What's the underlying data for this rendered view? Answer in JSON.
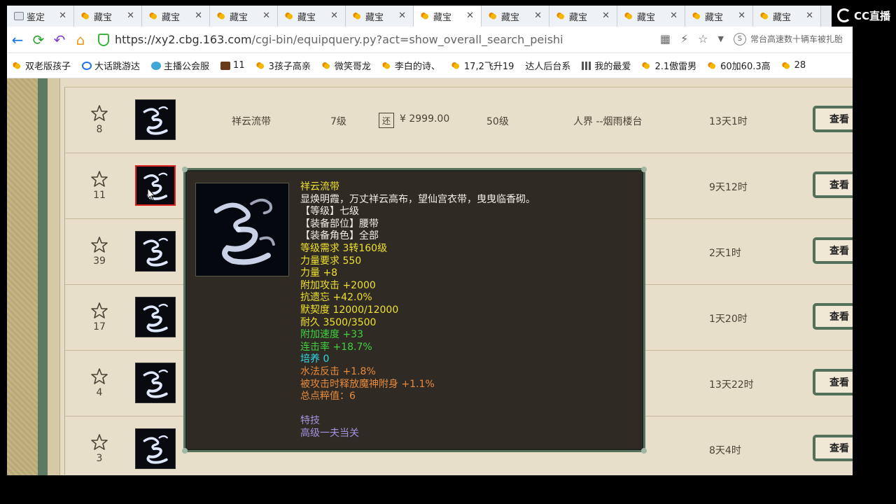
{
  "browser": {
    "tabs": [
      {
        "label": "鉴定"
      },
      {
        "label": "藏宝"
      },
      {
        "label": "藏宝"
      },
      {
        "label": "藏宝"
      },
      {
        "label": "藏宝"
      },
      {
        "label": "藏宝"
      },
      {
        "label": "藏宝"
      },
      {
        "label": "藏宝"
      },
      {
        "label": "藏宝"
      },
      {
        "label": "藏宝"
      },
      {
        "label": "藏宝"
      },
      {
        "label": "藏宝"
      }
    ],
    "active_tab_index": 6,
    "url_host": "https://xy2.cbg.163.com",
    "url_path": "/cgi-bin/equipquery.py?act=show_overall_search_peishi",
    "search_hint": "常台高速数十辆车被扎胎",
    "overlay_brand": "CC直播",
    "bookmarks": [
      {
        "label": "双老版孩子",
        "icon": "gold"
      },
      {
        "label": "大话跳游达",
        "icon": "blue"
      },
      {
        "label": "主播公会服",
        "icon": "teal"
      },
      {
        "label": "11",
        "icon": "game"
      },
      {
        "label": "3孩子高亲",
        "icon": "gold"
      },
      {
        "label": "微笑哥龙",
        "icon": "gold"
      },
      {
        "label": "李白的诗、",
        "icon": "gold"
      },
      {
        "label": "17,2飞升19",
        "icon": "gold"
      },
      {
        "label": "达人后台系",
        "icon": "page"
      },
      {
        "label": "我的最爱",
        "icon": "grid"
      },
      {
        "label": "2.1傲雷男",
        "icon": "gold"
      },
      {
        "label": "60加60.3高",
        "icon": "gold"
      },
      {
        "label": "28",
        "icon": "gold"
      }
    ]
  },
  "listing": {
    "view_label": "查看",
    "rows": [
      {
        "fav": "8",
        "name": "祥云流带",
        "level": "7级",
        "price": "¥ 2999.00",
        "req_level": "50级",
        "server": "人界 --烟雨楼台",
        "time_left": "13天1时",
        "selected": false
      },
      {
        "fav": "11",
        "name": "",
        "level": "",
        "price": "",
        "req_level": "",
        "server": "",
        "time_left": "9天12时",
        "selected": true
      },
      {
        "fav": "39",
        "name": "",
        "level": "",
        "price": "",
        "req_level": "",
        "server": "",
        "time_left": "2天1时",
        "selected": false
      },
      {
        "fav": "17",
        "name": "",
        "level": "",
        "price": "",
        "req_level": "",
        "server": "",
        "time_left": "1天20时",
        "selected": false
      },
      {
        "fav": "4",
        "name": "",
        "level": "",
        "price": "",
        "req_level": "",
        "server": "",
        "time_left": "13天22时",
        "selected": false
      },
      {
        "fav": "3",
        "name": "",
        "level": "",
        "price": "",
        "req_level": "",
        "server": "",
        "time_left": "8天4时",
        "selected": false
      }
    ]
  },
  "tooltip": {
    "lines": [
      {
        "text": "祥云流带",
        "color": "yellow"
      },
      {
        "text": "显焕明霞，万丈祥云高布，望仙宫衣带，曳曳临香砌。",
        "color": "white"
      },
      {
        "text": "【等级】七级",
        "color": "white"
      },
      {
        "text": "【装备部位】腰带",
        "color": "white"
      },
      {
        "text": "【装备角色】全部",
        "color": "white"
      },
      {
        "text": "等级需求 3转160级",
        "color": "yellow"
      },
      {
        "text": "力量要求 550",
        "color": "yellow"
      },
      {
        "text": "力量 +8",
        "color": "yellow"
      },
      {
        "text": "附加攻击 +2000",
        "color": "yellow"
      },
      {
        "text": "抗遗忘 +42.0%",
        "color": "yellow"
      },
      {
        "text": "默契度 12000/12000",
        "color": "yellow"
      },
      {
        "text": "耐久 3500/3500",
        "color": "yellow"
      },
      {
        "text": "附加速度 +33",
        "color": "green"
      },
      {
        "text": "连击率 +18.7%",
        "color": "green"
      },
      {
        "text": "培养 0",
        "color": "cyan"
      },
      {
        "text": "水法反击 +1.8%",
        "color": "orange"
      },
      {
        "text": "被攻击时释放魔神附身 +1.1%",
        "color": "orange"
      },
      {
        "text": "总点粹值：6",
        "color": "orange"
      },
      {
        "text": "",
        "color": "white"
      },
      {
        "text": "特技",
        "color": "purple"
      },
      {
        "text": "高级一夫当关",
        "color": "purple"
      }
    ]
  }
}
